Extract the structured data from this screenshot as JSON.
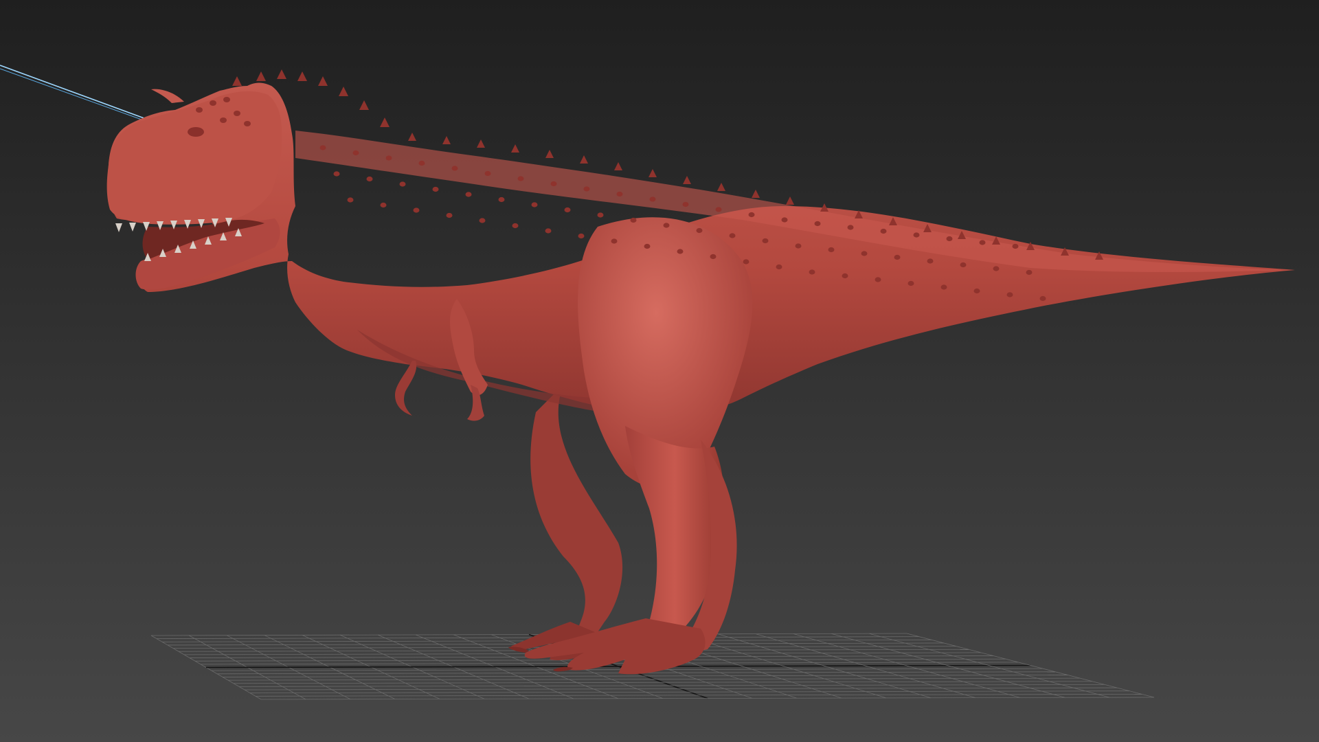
{
  "viewport": {
    "background_top": "#1f1f1f",
    "background_bottom": "#474747"
  },
  "grid": {
    "line_color": "#6a6a6a",
    "axis_color": "#151515"
  },
  "model": {
    "body_color": "#b4493f",
    "highlight_color": "#d56a5f",
    "shadow_color": "#7e2e28",
    "spike_color": "#8f332d"
  },
  "camera_line": {
    "color_a": "#9ed8ff",
    "color_b": "#5aa8e0"
  }
}
